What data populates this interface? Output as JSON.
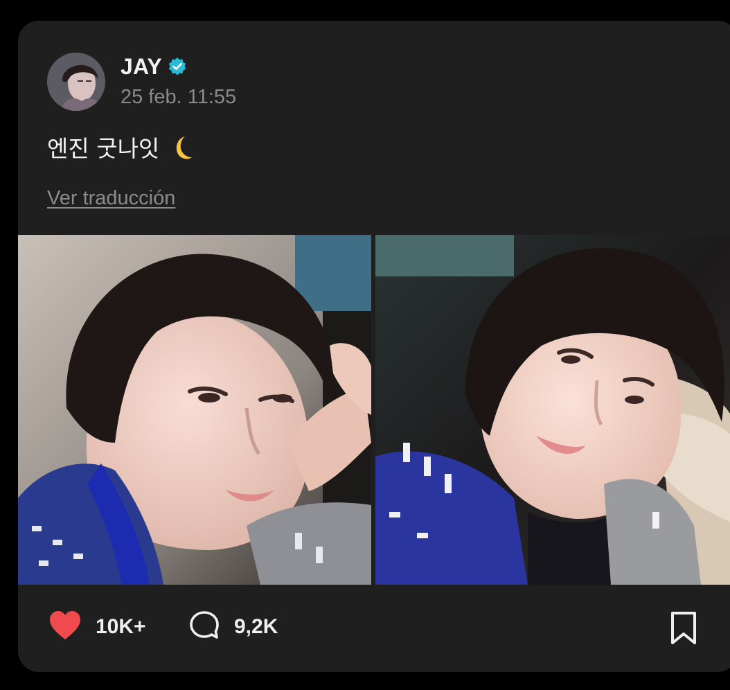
{
  "post": {
    "user_name": "JAY",
    "verified": true,
    "timestamp": "25 feb. 11:55",
    "text": "엔진 굿나잇",
    "text_emoji": "crescent-moon-icon",
    "translate_label": "Ver traducción"
  },
  "media": [
    {
      "name": "selfie-photo-peace-sign"
    },
    {
      "name": "selfie-photo-car-seat"
    }
  ],
  "actions": {
    "likes": "10K+",
    "comments": "9,2K",
    "like_color": "#f04a4f"
  },
  "colors": {
    "background": "#000000",
    "card": "#1f1f1f",
    "verified": "#2bb9d6",
    "muted": "#8a8a8a"
  }
}
